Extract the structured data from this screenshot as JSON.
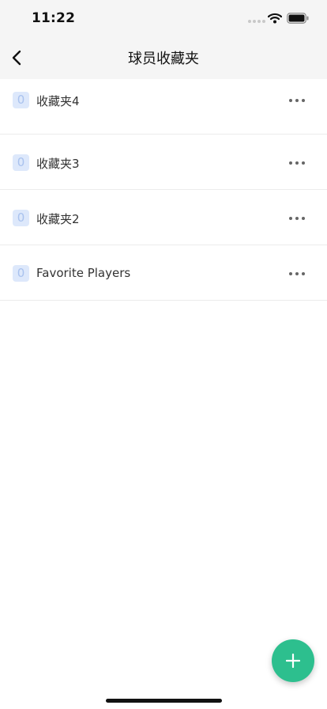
{
  "status_bar": {
    "time": "11:22",
    "icons": [
      "signal-dots-icon",
      "wifi-icon",
      "battery-icon"
    ]
  },
  "nav": {
    "back_icon": "chevron-left-icon",
    "title": "球员收藏夹"
  },
  "list": {
    "items": [
      {
        "count": "0",
        "label": "收藏夹4",
        "more_icon": "more-horizontal-icon"
      },
      {
        "count": "0",
        "label": "收藏夹3",
        "more_icon": "more-horizontal-icon"
      },
      {
        "count": "0",
        "label": "收藏夹2",
        "more_icon": "more-horizontal-icon"
      },
      {
        "count": "0",
        "label": "Favorite Players",
        "more_icon": "more-horizontal-icon"
      }
    ]
  },
  "fab": {
    "icon": "plus-icon"
  },
  "colors": {
    "header_bg": "#f5f5f5",
    "badge_bg": "#dde8fb",
    "badge_text": "#a9c2ee",
    "accent": "#2dbf8e",
    "divider": "#ececec"
  }
}
